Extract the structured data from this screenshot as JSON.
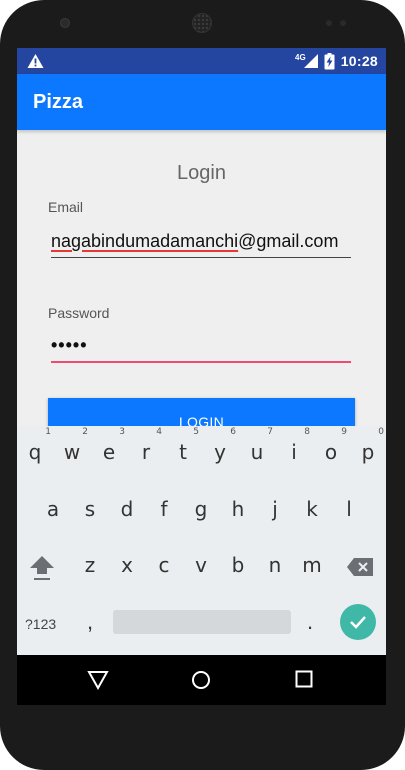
{
  "status_bar": {
    "network_label": "4G",
    "time": "10:28"
  },
  "app_bar": {
    "title": "Pizza"
  },
  "form": {
    "heading": "Login",
    "email_label": "Email",
    "email_value_misspelled": "nagabindumadamanchi",
    "email_value_rest": "@gmail.com",
    "password_label": "Password",
    "password_value": "•••••",
    "login_button_label": "LOGIN"
  },
  "keyboard": {
    "row1": [
      {
        "key": "q",
        "hint": "1"
      },
      {
        "key": "w",
        "hint": "2"
      },
      {
        "key": "e",
        "hint": "3"
      },
      {
        "key": "r",
        "hint": "4"
      },
      {
        "key": "t",
        "hint": "5"
      },
      {
        "key": "y",
        "hint": "6"
      },
      {
        "key": "u",
        "hint": "7"
      },
      {
        "key": "i",
        "hint": "8"
      },
      {
        "key": "o",
        "hint": "9"
      },
      {
        "key": "p",
        "hint": "0"
      }
    ],
    "row2": [
      "a",
      "s",
      "d",
      "f",
      "g",
      "h",
      "j",
      "k",
      "l"
    ],
    "row3": [
      "z",
      "x",
      "c",
      "v",
      "b",
      "n",
      "m"
    ],
    "symbols_label": "?123",
    "comma": ",",
    "period": "."
  },
  "colors": {
    "status_bar": "#2445a0",
    "app_bar": "#0b78ff",
    "accent_password": "#ee4a73",
    "done_key": "#3fb8a8"
  },
  "icons": {
    "status": [
      "warning-icon",
      "signal-icon",
      "battery-charging-icon"
    ],
    "nav": [
      "back-icon",
      "home-icon",
      "recents-icon"
    ]
  }
}
